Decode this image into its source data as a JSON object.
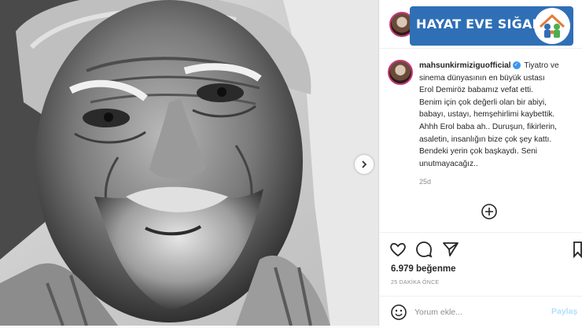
{
  "brand": {
    "banner_text": "HAYAT EVE SIĞAR"
  },
  "post": {
    "username": "mahsunkirmiziguofficial",
    "caption_lines": [
      "Tiyatro ve",
      "sinema dünyasının en büyük ustası",
      "Erol Demiröz babamız vefat etti.",
      "Benim için çok değerli olan bir abiyi,",
      "babayı, ustayı, hemşehirlimi kaybettik.",
      "Ahhh Erol baba ah.. Duruşun, fikirlerin,",
      "asaletin, insanlığın bize çok şey kattı.",
      "Bendeki yerin çok başkaydı. Seni",
      "unutmayacağız.."
    ],
    "time_ago": "25d",
    "likes": "6.979 beğenme",
    "posted_ago": "25 DAKİKA ÖNCE"
  },
  "comment": {
    "placeholder": "Yorum ekle...",
    "post_label": "Paylaş"
  },
  "icons": {
    "next": "chevron-right-icon",
    "add_comment": "plus-circle-icon",
    "like": "heart-icon",
    "comment": "comment-bubble-icon",
    "share": "paper-plane-icon",
    "save": "bookmark-icon",
    "emoji": "smile-icon"
  },
  "colors": {
    "brand_blue": "#2f6fb6",
    "verified_blue": "#3897f0",
    "muted_text": "#8e8e8e",
    "post_button_disabled": "#b2dffc"
  }
}
